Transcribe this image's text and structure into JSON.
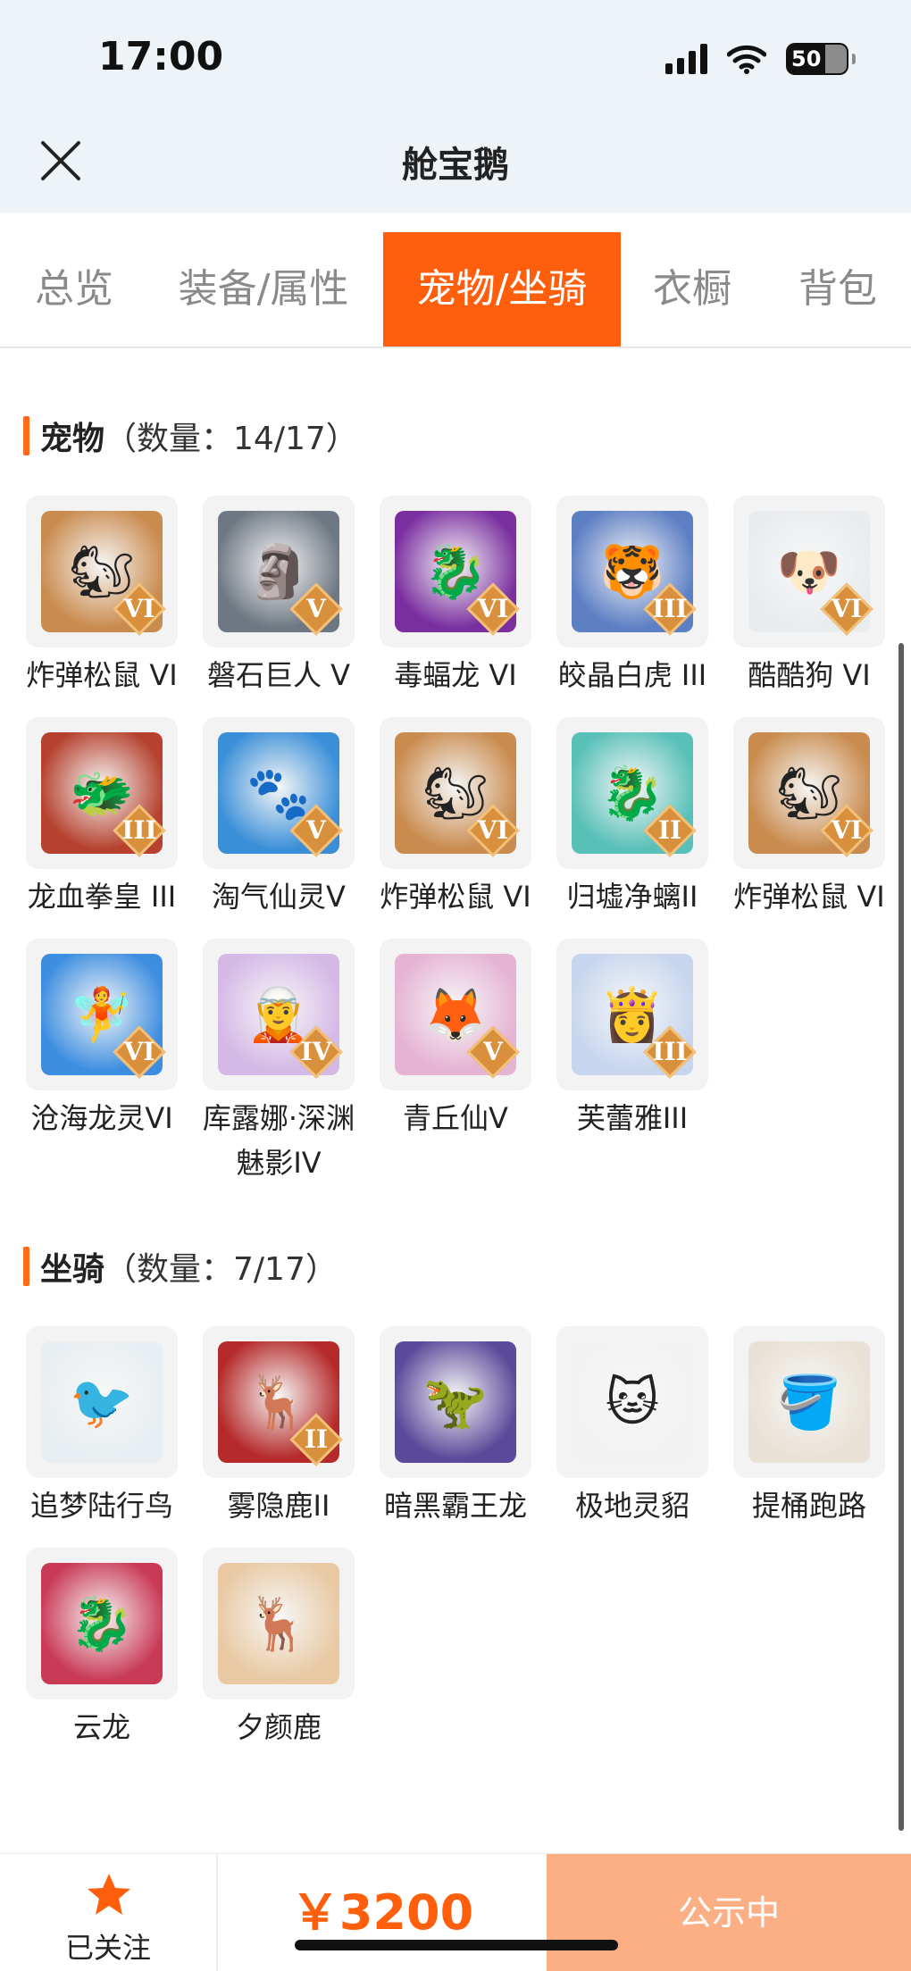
{
  "status_bar": {
    "time": "17:00",
    "battery": "50"
  },
  "nav": {
    "title": "舱宝鹅"
  },
  "tabs": [
    {
      "label": "总览",
      "active": false
    },
    {
      "label": "装备/属性",
      "active": false
    },
    {
      "label": "宠物/坐骑",
      "active": true
    },
    {
      "label": "衣橱",
      "active": false
    },
    {
      "label": "背包",
      "active": false
    }
  ],
  "pets": {
    "title": "宠物",
    "count": "（数量：14/17）",
    "items": [
      {
        "name": "炸弹松鼠 VI",
        "rank": "VI",
        "color": "#c98b4e",
        "glyph": "🐿"
      },
      {
        "name": "磐石巨人 V",
        "rank": "V",
        "color": "#6e7882",
        "glyph": "🗿"
      },
      {
        "name": "毒蝠龙 VI",
        "rank": "VI",
        "color": "#7a2fa0",
        "glyph": "🐉"
      },
      {
        "name": "皎晶白虎 III",
        "rank": "III",
        "color": "#5d7fc4",
        "glyph": "🐯"
      },
      {
        "name": "酷酷狗 VI",
        "rank": "VI",
        "color": "#e9ecef",
        "glyph": "🐶"
      },
      {
        "name": "龙血拳皇 III",
        "rank": "III",
        "color": "#b5412e",
        "glyph": "🐲"
      },
      {
        "name": "淘气仙灵V",
        "rank": "V",
        "color": "#3a8fd8",
        "glyph": "🐾"
      },
      {
        "name": "炸弹松鼠 VI",
        "rank": "VI",
        "color": "#c98b4e",
        "glyph": "🐿"
      },
      {
        "name": "归墟净螭II",
        "rank": "II",
        "color": "#58c0b8",
        "glyph": "🐉"
      },
      {
        "name": "炸弹松鼠 VI",
        "rank": "VI",
        "color": "#c98b4e",
        "glyph": "🐿"
      },
      {
        "name": "沧海龙灵VI",
        "rank": "VI",
        "color": "#3d8ee0",
        "glyph": "🧚"
      },
      {
        "name": "库露娜·深渊魅影IV",
        "rank": "IV",
        "color": "#d4b8e6",
        "glyph": "🧝"
      },
      {
        "name": "青丘仙V",
        "rank": "V",
        "color": "#e5b3d3",
        "glyph": "🦊"
      },
      {
        "name": "芙蕾雅III",
        "rank": "III",
        "color": "#c7d6ee",
        "glyph": "👸"
      }
    ]
  },
  "mounts": {
    "title": "坐骑",
    "count": "（数量：7/17）",
    "items": [
      {
        "name": "追梦陆行鸟",
        "rank": "",
        "color": "#e8eef2",
        "glyph": "🐦"
      },
      {
        "name": "雾隐鹿II",
        "rank": "II",
        "color": "#b52a2a",
        "glyph": "🦌"
      },
      {
        "name": "暗黑霸王龙",
        "rank": "",
        "color": "#5b4a9a",
        "glyph": "🦖"
      },
      {
        "name": "极地灵貂",
        "rank": "",
        "color": "#f2f2f2",
        "glyph": "🐱"
      },
      {
        "name": "提桶跑路",
        "rank": "",
        "color": "#e8e2d6",
        "glyph": "🪣"
      },
      {
        "name": "云龙",
        "rank": "",
        "color": "#c93a56",
        "glyph": "🐉"
      },
      {
        "name": "夕颜鹿",
        "rank": "",
        "color": "#e8c9a3",
        "glyph": "🦌"
      }
    ]
  },
  "bottom": {
    "follow_label": "已关注",
    "price": "￥3200",
    "status_button": "公示中"
  },
  "colors": {
    "accent": "#ff5f0d",
    "button_disabled": "#fcae85",
    "header_bg": "#eef3f7"
  }
}
